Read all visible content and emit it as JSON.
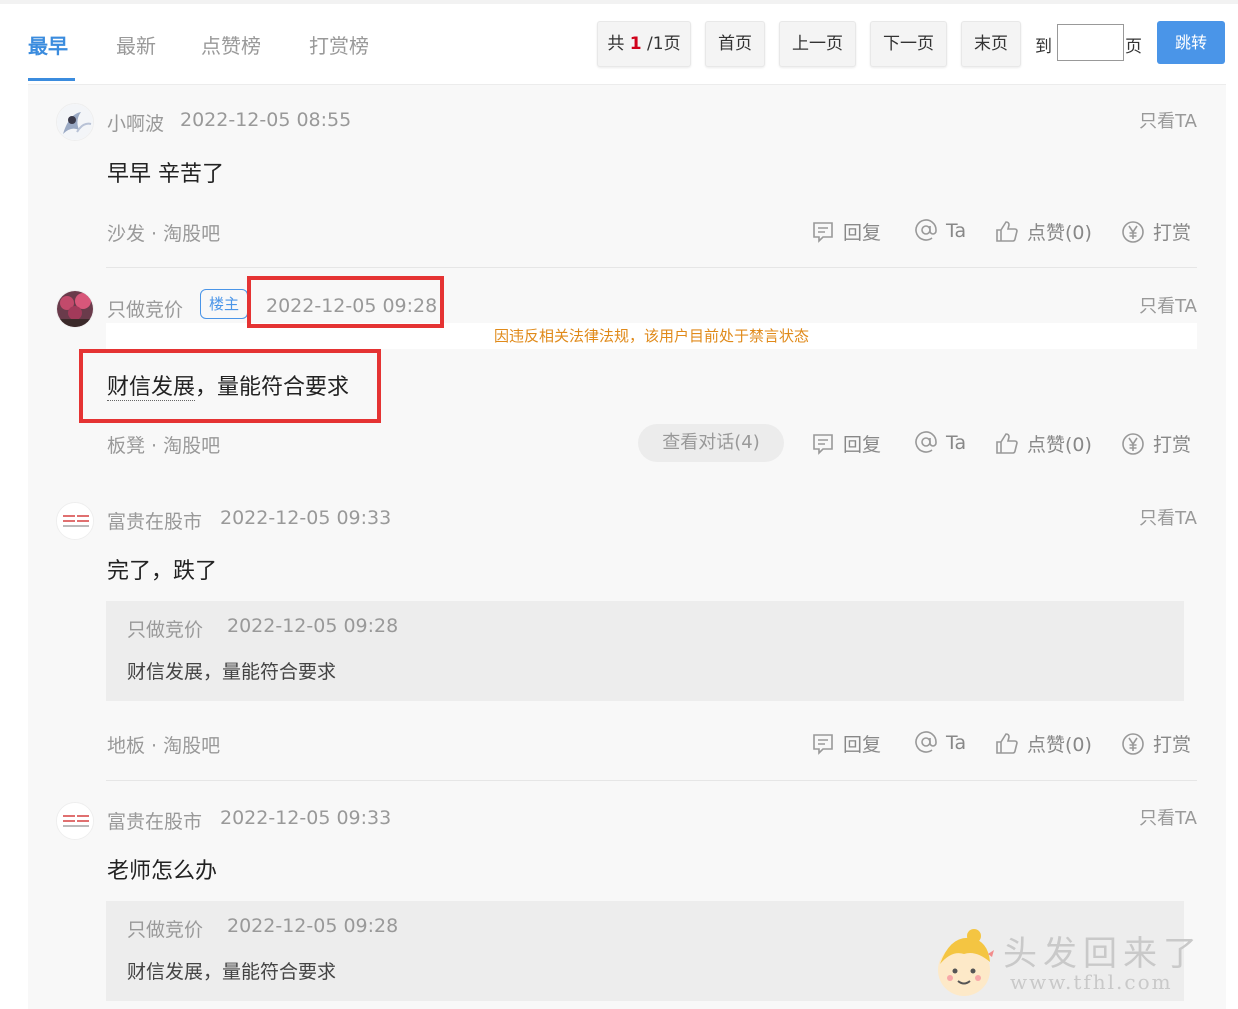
{
  "tabs": [
    {
      "label": "最早",
      "active": true
    },
    {
      "label": "最新",
      "active": false
    },
    {
      "label": "点赞榜",
      "active": false
    },
    {
      "label": "打赏榜",
      "active": false
    }
  ],
  "pager": {
    "total_prefix": "共",
    "current": "1",
    "total_suffix": "/1页",
    "first": "首页",
    "prev": "上一页",
    "next": "下一页",
    "last": "末页",
    "goto_label": "到",
    "page_unit": "页",
    "input_value": "",
    "jump": "跳转"
  },
  "labels": {
    "only_ta": "只看TA",
    "reply": "回复",
    "at": "Ta",
    "like": "点赞(0)",
    "tip": "打赏",
    "louzhu": "楼主",
    "view_conversation": "查看对话(4)",
    "banned_notice": "因违反相关法律法规，该用户目前处于禁言状态"
  },
  "posts": [
    {
      "user": "小啊波",
      "time": "2022-12-05 08:55",
      "content": "早早 辛苦了",
      "floor": "沙发 · 淘股吧"
    },
    {
      "user": "只做竞价",
      "time": "2022-12-05 09:28",
      "content_a": "财信发展",
      "content_b": "，量能符合要求",
      "floor": "板凳 · 淘股吧"
    },
    {
      "user": "富贵在股市",
      "time": "2022-12-05 09:33",
      "content": "完了，跌了",
      "floor": "地板 · 淘股吧",
      "quote": {
        "user": "只做竞价",
        "time": "2022-12-05 09:28",
        "text": "财信发展，量能符合要求"
      }
    },
    {
      "user": "富贵在股市",
      "time": "2022-12-05 09:33",
      "content": "老师怎么办",
      "quote": {
        "user": "只做竞价",
        "time": "2022-12-05 09:28",
        "text": "财信发展，量能符合要求"
      }
    }
  ],
  "watermark": {
    "text": "头发回来了",
    "url": "www.tfhl.com"
  },
  "colors": {
    "accent": "#3b8cde",
    "highlight_box": "#e53333",
    "banned_text": "#e08a1a"
  }
}
